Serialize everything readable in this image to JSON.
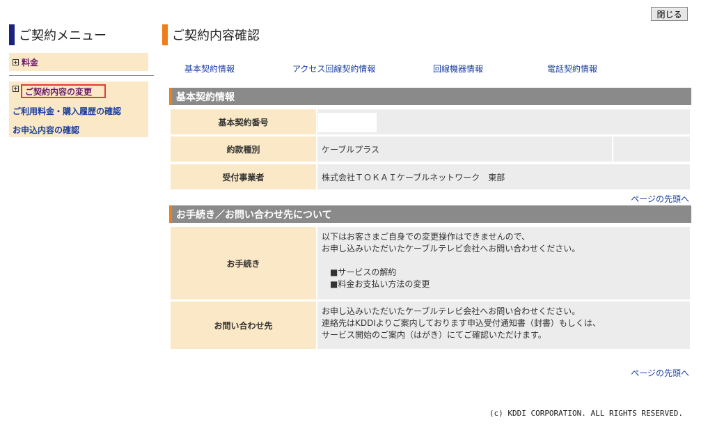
{
  "close_label": "閉じる",
  "sidebar": {
    "title": "ご契約メニュー",
    "item_fee": "料金",
    "item_change": "ご契約内容の変更",
    "item_history": "ご利用料金・購入履歴の確認",
    "item_application": "お申込内容の確認"
  },
  "main": {
    "title": "ご契約内容確認",
    "tabs": [
      "基本契約情報",
      "アクセス回線契約情報",
      "回線機器情報",
      "電話契約情報"
    ],
    "basic": {
      "header": "基本契約情報",
      "rows": [
        {
          "label": "基本契約番号",
          "value": ""
        },
        {
          "label": "約款種別",
          "value": "ケーブルプラス"
        },
        {
          "label": "受付事業者",
          "value": "株式会社ＴＯＫＡＩケーブルネットワーク　東部"
        }
      ]
    },
    "page_top": "ページの先頭へ",
    "procedures": {
      "header": "お手続き／お問い合わせ先について",
      "procedure_label": "お手続き",
      "procedure_lines": [
        "以下はお客さまご自身での変更操作はできませんので、",
        "お申し込みいただいたケーブルテレビ会社へお問い合わせください。",
        "",
        "　■サービスの解約",
        "　■料金お支払い方法の変更"
      ],
      "contact_label": "お問い合わせ先",
      "contact_lines": [
        "お申し込みいただいたケーブルテレビ会社へお問い合わせください。",
        "連絡先はKDDIよりご案内しております申込受付通知書（封書）もしくは、",
        "サービス開始のご案内（はがき）にてご確認いただけます。"
      ]
    }
  },
  "footer": "(c) KDDI CORPORATION. ALL RIGHTS RESERVED."
}
